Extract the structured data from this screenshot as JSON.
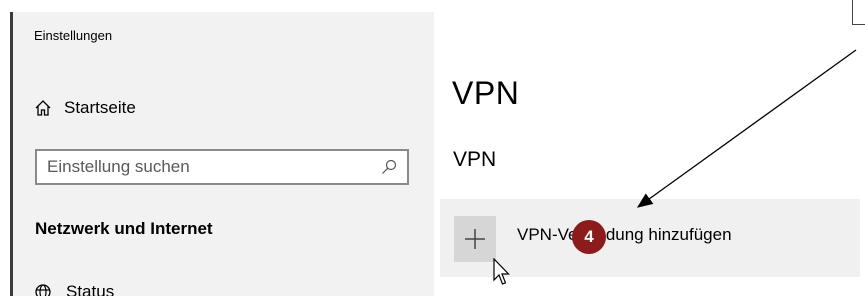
{
  "window": {
    "title": "Einstellungen"
  },
  "sidebar": {
    "home_label": "Startseite",
    "search_placeholder": "Einstellung suchen",
    "section_heading": "Netzwerk und Internet",
    "items": [
      {
        "label": "Status",
        "icon": "globe-icon"
      }
    ]
  },
  "main": {
    "title": "VPN",
    "subtitle": "VPN",
    "add_vpn_label": "VPN-Verbindung hinzufügen",
    "add_vpn_label_visible": "VPN-Verbindung hinzufügen"
  },
  "annotation": {
    "step_number": "4",
    "badge_color": "#8e1b1b"
  },
  "colors": {
    "sidebar_bg": "#f2f2f2",
    "tile_bg": "#d6d6d6",
    "row_bg": "#f0f0f0"
  }
}
